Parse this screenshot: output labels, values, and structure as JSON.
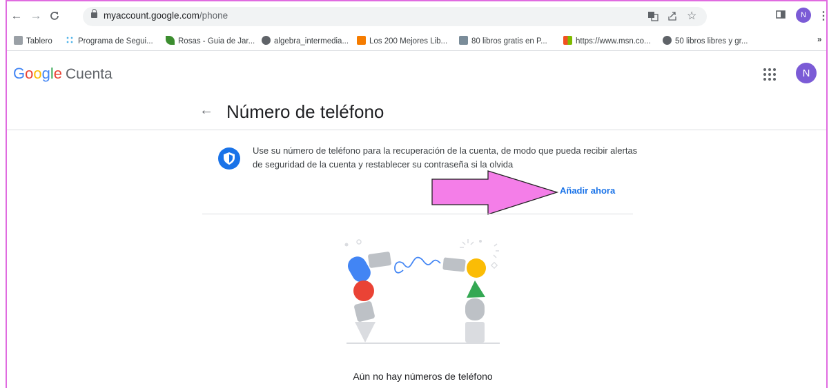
{
  "browser": {
    "url_host": "myaccount.google.com",
    "url_path": "/phone",
    "profile_initial": "N"
  },
  "bookmarks": [
    {
      "label": "Tablero",
      "color": "#9aa0a6"
    },
    {
      "label": "Programa de Segui...",
      "color": "#4fb3e8"
    },
    {
      "label": "Rosas - Guia de Jar...",
      "color": "#3c8d2f"
    },
    {
      "label": "algebra_intermedia...",
      "color": "#5f6368"
    },
    {
      "label": "Los 200 Mejores Lib...",
      "color": "#f57c00"
    },
    {
      "label": "80 libros gratis en P...",
      "color": "#7a8c99"
    },
    {
      "label": "https://www.msn.co...",
      "color": "#00a4ef"
    },
    {
      "label": "50 libros libres y gr...",
      "color": "#5f6368"
    }
  ],
  "bookmarks_overflow": "»",
  "header": {
    "logo_parts": [
      "G",
      "o",
      "o",
      "g",
      "l",
      "e"
    ],
    "product": "Cuenta",
    "avatar_initial": "N"
  },
  "page": {
    "title": "Número de teléfono",
    "info_text": "Use su número de teléfono para la recuperación de la cuenta, de modo que pueda recibir alertas de seguridad de la cuenta y restablecer su contraseña si la olvida",
    "add_now_label": "Añadir ahora",
    "empty_state": "Aún no hay números de teléfono"
  },
  "colors": {
    "accent": "#1a73e8",
    "annotation_arrow": "#f47ee8",
    "window_border": "#e06be0"
  },
  "icons": {
    "back": "arrow-left-icon",
    "forward": "arrow-right-icon",
    "reload": "reload-icon",
    "lock": "lock-icon",
    "translate": "translate-icon",
    "share": "share-icon",
    "star": "star-icon",
    "sidepanel": "side-panel-icon",
    "menu": "more-vert-icon",
    "apps": "apps-grid-icon",
    "shield": "shield-icon"
  }
}
